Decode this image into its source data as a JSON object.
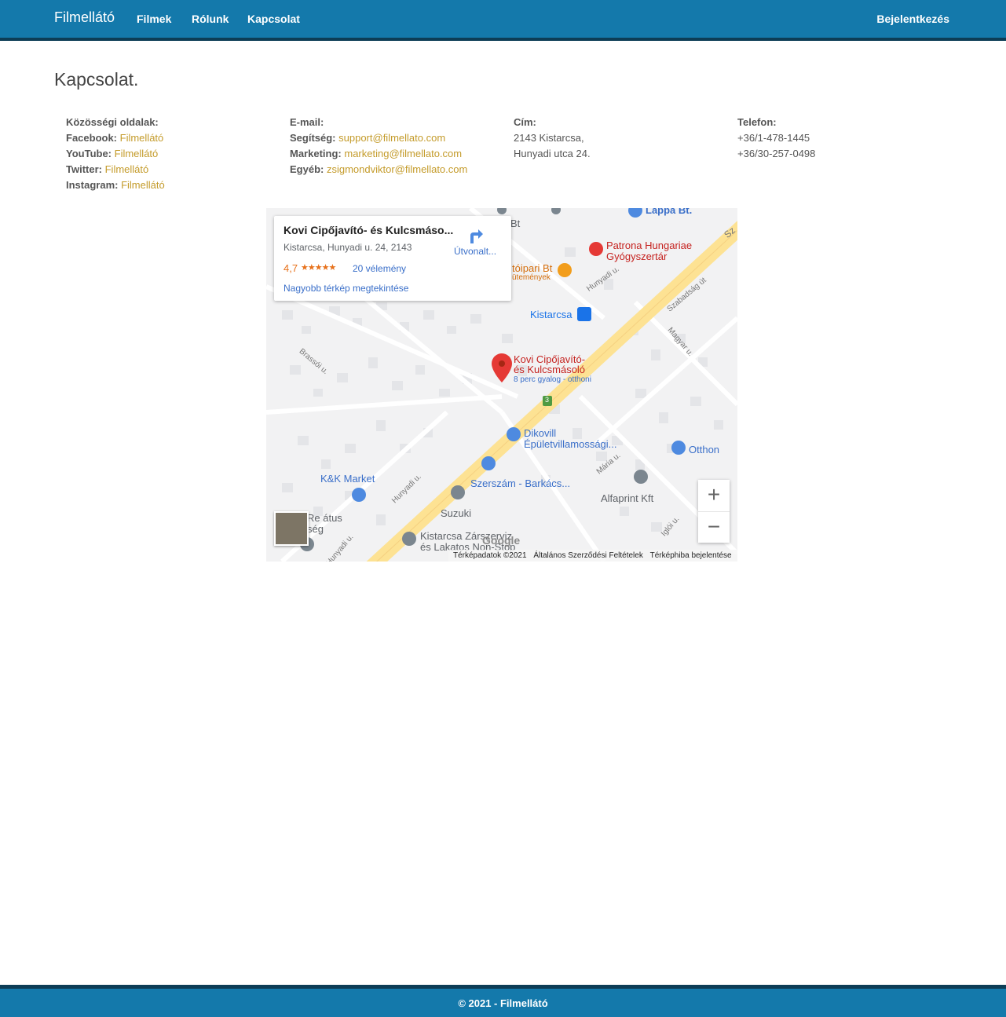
{
  "nav": {
    "brand": "Filmellátó",
    "films": "Filmek",
    "about": "Rólunk",
    "contact": "Kapcsolat",
    "login": "Bejelentkezés"
  },
  "page_title": "Kapcsolat.",
  "social": {
    "heading": "Közösségi oldalak:",
    "items": [
      {
        "label": "Facebook:",
        "link": "Filmellátó"
      },
      {
        "label": "YouTube:",
        "link": "Filmellátó"
      },
      {
        "label": "Twitter:",
        "link": "Filmellátó"
      },
      {
        "label": "Instagram:",
        "link": "Filmellátó"
      }
    ]
  },
  "email": {
    "heading": "E-mail:",
    "items": [
      {
        "label": "Segítség:",
        "link": "support@filmellato.com"
      },
      {
        "label": "Marketing:",
        "link": "marketing@filmellato.com"
      },
      {
        "label": "Egyéb:",
        "link": "zsigmondviktor@filmellato.com"
      }
    ]
  },
  "address": {
    "heading": "Cím:",
    "line1": "2143 Kistarcsa,",
    "line2": "Hunyadi utca 24."
  },
  "phone": {
    "heading": "Telefon:",
    "line1": "+36/1-478-1445",
    "line2": "+36/30-257-0498"
  },
  "map": {
    "card_title": "Kovi Cipőjavító- és Kulcsmáso...",
    "card_address": "Kistarcsa, Hunyadi u. 24, 2143",
    "rating": "4,7",
    "stars": "★★★★★",
    "reviews": "20 vélemény",
    "larger_map": "Nagyobb térkép megtekintése",
    "directions": "Útvonalt...",
    "labels": {
      "lappa": "Lappa Bt.",
      "patrona1": "Patrona Hungariae",
      "patrona2": "Gyógyszertár",
      "toipari": "tóipari Bt",
      "utemenyek": "ütemények",
      "kistarcsa": "Kistarcsa",
      "kovi1": "Kovi Cipőjavító-",
      "kovi2": "és Kulcsmásoló",
      "kovi3": "8 perc gyalog - otthoni",
      "dikovill1": "Dikovill",
      "dikovill2": "Épületvillamossági...",
      "otthon": "Otthon",
      "kk": "K&K Market",
      "szerszam": "Szerszám - Barkács...",
      "alfaprint": "Alfaprint Kft",
      "suzuki": "Suzuki",
      "zarszerviz1": "Kistarcsa Zárszerviz",
      "zarszerviz2": "és Lakatos Non-Stop",
      "reformatus1": "Re átus",
      "reformatus2": "ség",
      "hunyadi_u": "Hunyadi u.",
      "brassoi": "Brassói u.",
      "szabadsag": "Szabadság út",
      "magyar": "Magyar u.",
      "maria": "Mária u.",
      "igloi": "Iglói u.",
      "route3": "3",
      "bt": "Bt",
      "sz": "Sz"
    },
    "zoom_in": "+",
    "zoom_out": "−",
    "google": "Google",
    "footer_data": "Térképadatok ©2021",
    "footer_terms": "Általános Szerződési Feltételek",
    "footer_report": "Térképhiba bejelentése"
  },
  "footer": "© 2021 - Filmellátó"
}
